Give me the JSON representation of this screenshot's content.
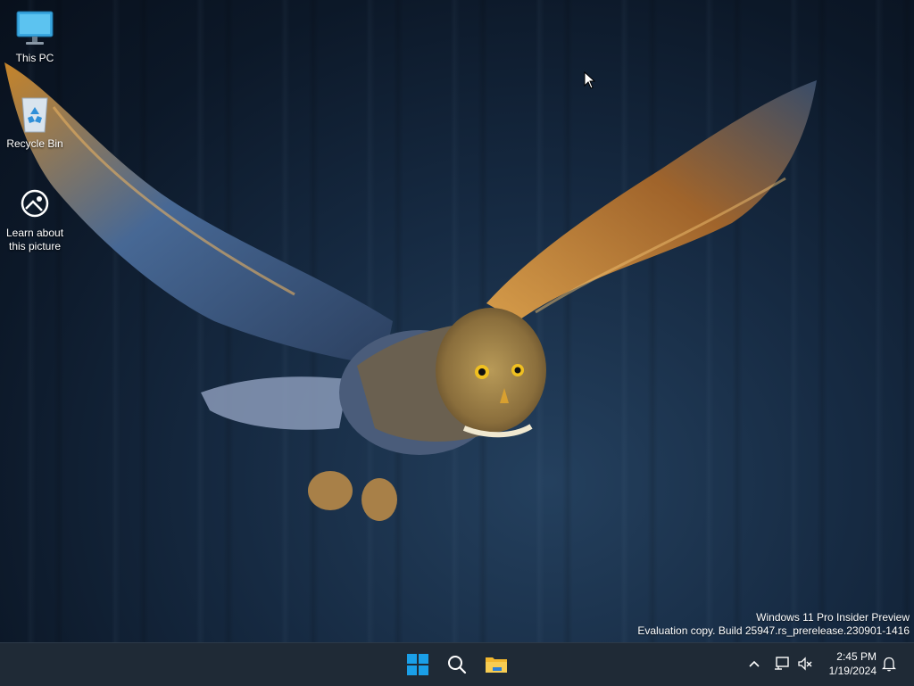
{
  "desktop": {
    "icons": [
      {
        "label": "This PC",
        "icon": "monitor-icon"
      },
      {
        "label": "Recycle Bin",
        "icon": "recycle-bin-icon"
      },
      {
        "label": "Learn about this picture",
        "icon": "info-picture-icon"
      }
    ],
    "watermark": {
      "line1": "Windows 11 Pro Insider Preview",
      "line2": "Evaluation copy. Build 25947.rs_prerelease.230901-1416"
    }
  },
  "taskbar": {
    "pinned": [
      {
        "name": "start",
        "icon": "windows-logo-icon"
      },
      {
        "name": "search",
        "icon": "search-icon"
      },
      {
        "name": "file-explorer",
        "icon": "folder-icon"
      }
    ],
    "tray": {
      "icons": [
        "chevron-up-icon",
        "network-icon",
        "volume-muted-icon"
      ],
      "time": "2:45 PM",
      "date": "1/19/2024",
      "notification_icon": "bell-icon"
    }
  },
  "colors": {
    "accent": "#0078d4",
    "taskbar": "#1f2a36",
    "folder": "#f2b72f"
  }
}
